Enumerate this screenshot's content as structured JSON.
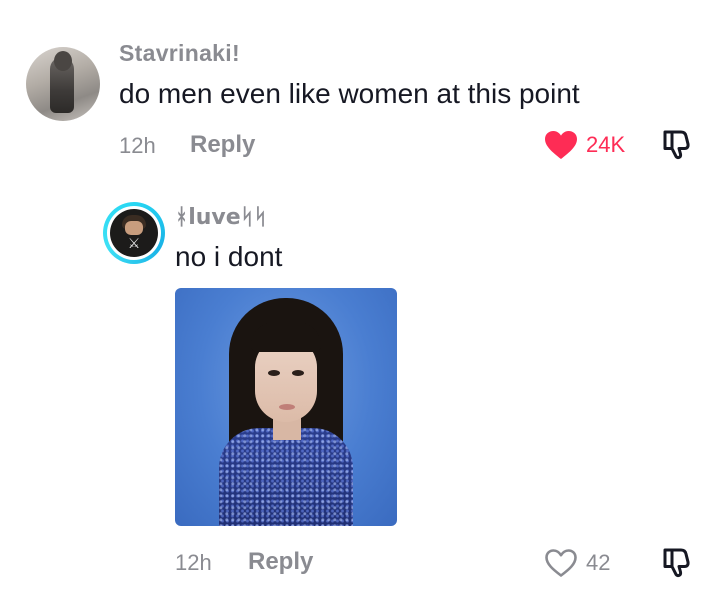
{
  "comment": {
    "username": "Stavrinaki!",
    "text": "do men even like women at this point",
    "time": "12h",
    "reply_label": "Reply",
    "likes": "24K",
    "liked": true,
    "like_color": "#fe2c55"
  },
  "reply": {
    "username": "ᚼluveᛋᛋ",
    "text": "no i dont",
    "time": "12h",
    "reply_label": "Reply",
    "likes": "42",
    "liked": false,
    "avatar_ring_color": "#27d7f3"
  },
  "icons": {
    "like": "heart-icon",
    "dislike": "thumbs-down-icon"
  }
}
